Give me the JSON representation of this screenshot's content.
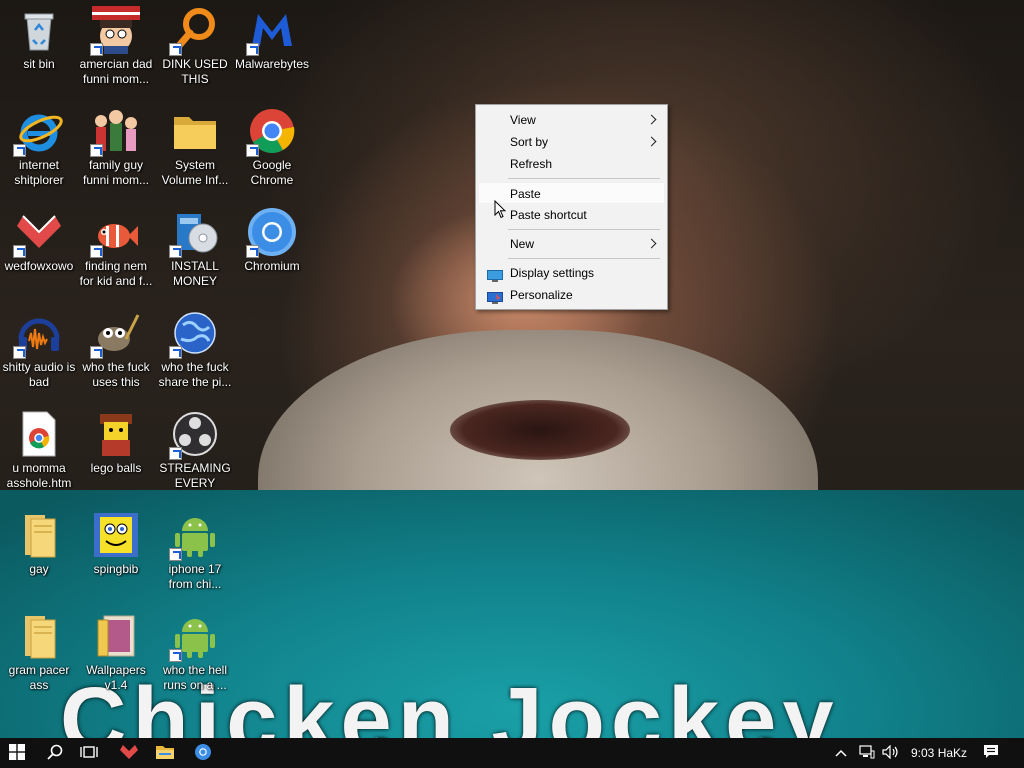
{
  "wallpaper": {
    "caption": "Chicken Jockey"
  },
  "desktop_icons": [
    {
      "label": "sit bin",
      "icon": "recycle-bin-icon"
    },
    {
      "label": "amercian dad funni mom...",
      "icon": "cartoon-dad-icon"
    },
    {
      "label": "DINK USED THIS",
      "icon": "magnifier-app-icon"
    },
    {
      "label": "Malwarebytes",
      "icon": "malwarebytes-icon"
    },
    {
      "label": "internet shitplorer",
      "icon": "internet-explorer-icon"
    },
    {
      "label": "family guy funni mom...",
      "icon": "cartoon-family-icon"
    },
    {
      "label": "System Volume Inf...",
      "icon": "folder-icon"
    },
    {
      "label": "Google Chrome",
      "icon": "chrome-icon"
    },
    {
      "label": "wedfowxowo",
      "icon": "red-pixel-app-icon"
    },
    {
      "label": "finding nem for kid and f...",
      "icon": "fish-icon"
    },
    {
      "label": "INSTALL MONEY",
      "icon": "installer-cd-icon"
    },
    {
      "label": "Chromium",
      "icon": "chromium-icon"
    },
    {
      "label": "shitty audio is bad",
      "icon": "audacity-icon"
    },
    {
      "label": "who the fuck uses this",
      "icon": "gimp-icon"
    },
    {
      "label": "who the fuck share the pi...",
      "icon": "globe-icon"
    },
    {
      "label": "u momma asshole.htm",
      "icon": "chrome-html-file-icon"
    },
    {
      "label": "lego balls",
      "icon": "lego-figure-icon"
    },
    {
      "label": "STREAMING EVERY DAY...",
      "icon": "obs-icon"
    },
    {
      "label": "gay",
      "icon": "folder-icon"
    },
    {
      "label": "spingbib",
      "icon": "sponge-icon"
    },
    {
      "label": "iphone 17 from chi...",
      "icon": "android-icon"
    },
    {
      "label": "gram pacer ass",
      "icon": "folder-icon"
    },
    {
      "label": "Wallpapers v1.4",
      "icon": "wallpapers-icon"
    },
    {
      "label": "who the hell runs on a ...",
      "icon": "android-icon"
    }
  ],
  "context_menu": {
    "items": [
      {
        "label": "View",
        "submenu": true
      },
      {
        "label": "Sort by",
        "submenu": true
      },
      {
        "label": "Refresh",
        "submenu": false
      },
      {
        "label": "Paste",
        "submenu": false,
        "highlighted": true
      },
      {
        "label": "Paste shortcut",
        "submenu": false
      },
      {
        "label": "New",
        "submenu": true
      },
      {
        "label": "Display settings",
        "submenu": false,
        "icon": "display-settings-icon"
      },
      {
        "label": "Personalize",
        "submenu": false,
        "icon": "personalize-icon"
      }
    ]
  },
  "taskbar": {
    "pinned": [
      "windows-start-icon",
      "search-icon",
      "task-view-icon",
      "red-pixel-app-icon",
      "file-explorer-icon",
      "chromium-icon"
    ],
    "tray": {
      "clock": "9:03 HaKz",
      "icons": [
        "show-hidden-icons-chevron",
        "network-icon",
        "volume-icon",
        "notifications-icon"
      ]
    }
  },
  "colors": {
    "taskbar_bg": "#101010",
    "menu_bg": "#f2f2f2",
    "wallpaper_shirt": "#11818a"
  }
}
